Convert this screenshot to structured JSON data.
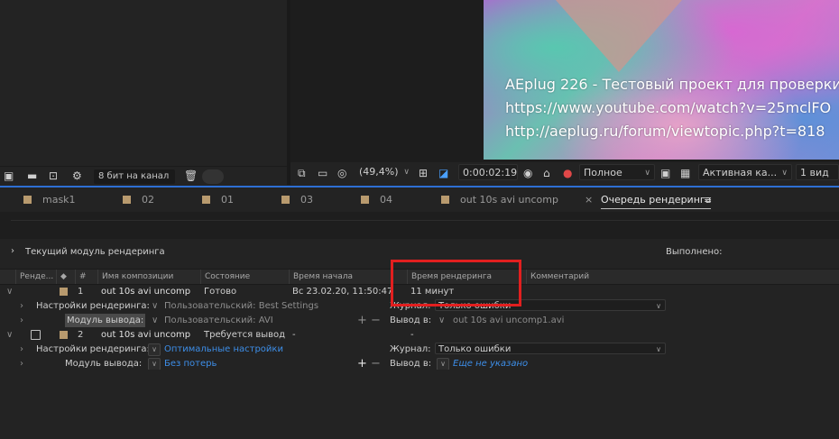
{
  "project_bar": {
    "bit_depth": "8 бит на канал"
  },
  "viewer": {
    "overlay_lines": [
      "AEplug 226 - Тестовый проект для проверки",
      "https://www.youtube.com/watch?v=25mclFO",
      "http://aeplug.ru/forum/viewtopic.php?t=818"
    ],
    "zoom": "(49,4%)",
    "timecode": "0:00:02:19",
    "resolution": "Полное",
    "camera": "Активная ка...",
    "views": "1 вид"
  },
  "tabs": [
    {
      "label": "mask1"
    },
    {
      "label": "02"
    },
    {
      "label": "01"
    },
    {
      "label": "03"
    },
    {
      "label": "04"
    },
    {
      "label": "out 10s avi uncomp"
    },
    {
      "label": "Очередь рендеринга"
    }
  ],
  "render_queue": {
    "current_module_label": "Текущий модуль рендеринга",
    "done_label": "Выполнено:",
    "columns": {
      "render": "Ренде...",
      "num": "#",
      "comp_name": "Имя композиции",
      "status": "Состояние",
      "start_time": "Время начала",
      "render_time": "Время рендеринга",
      "comment": "Комментарий"
    },
    "items": [
      {
        "num": "1",
        "comp_name": "out 10s avi uncomp",
        "status": "Готово",
        "start_time": "Вс 23.02.20, 11:50:47",
        "render_time": "11 минут",
        "render_settings_label": "Настройки рендеринга:",
        "render_settings_value": "Пользовательский: Best Settings",
        "log_label": "Журнал:",
        "log_value": "Только ошибки",
        "output_module_label": "Модуль вывода:",
        "output_module_value": "Пользовательский: AVI",
        "output_to_label": "Вывод в:",
        "output_to_value": "out 10s avi uncomp1.avi"
      },
      {
        "num": "2",
        "comp_name": "out 10s avi uncomp",
        "status": "Требуется вывод",
        "start_time": "-",
        "render_time": "-",
        "render_settings_label": "Настройки рендеринга:",
        "render_settings_value": "Оптимальные настройки",
        "log_label": "Журнал:",
        "log_value": "Только ошибки",
        "output_module_label": "Модуль вывода:",
        "output_module_value": "Без потерь",
        "output_to_label": "Вывод в:",
        "output_to_value": "Еще не указано"
      }
    ]
  },
  "colors": {
    "accent_blue": "#2e6fd3",
    "link_blue": "#3d8ee8",
    "highlight_red": "#e21f1f",
    "label_swatch": "#b89a6e"
  }
}
